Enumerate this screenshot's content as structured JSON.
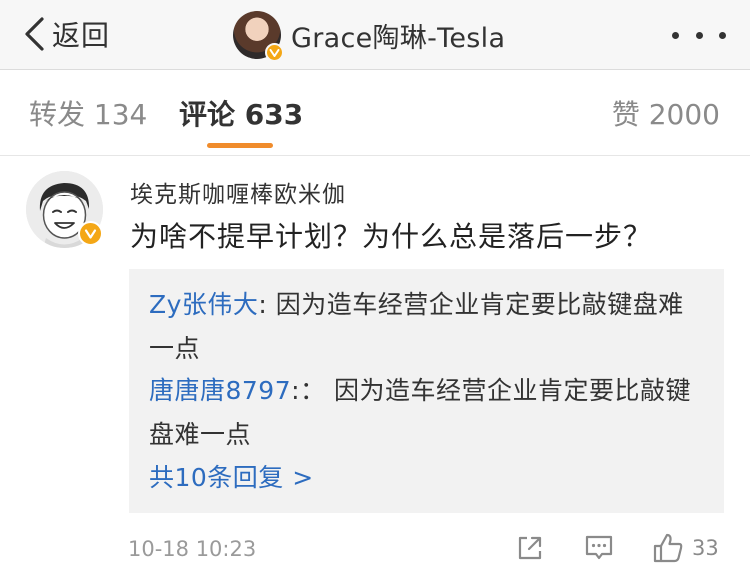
{
  "nav": {
    "back_label": "返回",
    "title": "Grace陶琳-Tesla",
    "icons": {
      "back": "chevron-left-icon",
      "more": "more-dots-icon",
      "verified": "verified-badge-icon"
    },
    "colors": {
      "verified": "#f4a716"
    }
  },
  "tabs": {
    "repost": "转发 134",
    "comment": "评论 633",
    "like": "赞 2000",
    "active": "comment",
    "accent": "#f08c2c"
  },
  "comment": {
    "username": "埃克斯咖喱棒欧米伽",
    "text": "为啥不提早计划？为什么总是落后一步？",
    "replies": [
      {
        "name": "Zy张伟大",
        "text": ": 因为造车经营企业肯定要比敲键盘难一点"
      },
      {
        "name": "唐唐唐8797",
        "text": ":： 因为造车经营企业肯定要比敲键盘难一点"
      }
    ],
    "more_replies": "共10条回复 >",
    "timestamp": "10-18 10:23",
    "like_count": "33",
    "link_color": "#2d6cbf"
  }
}
